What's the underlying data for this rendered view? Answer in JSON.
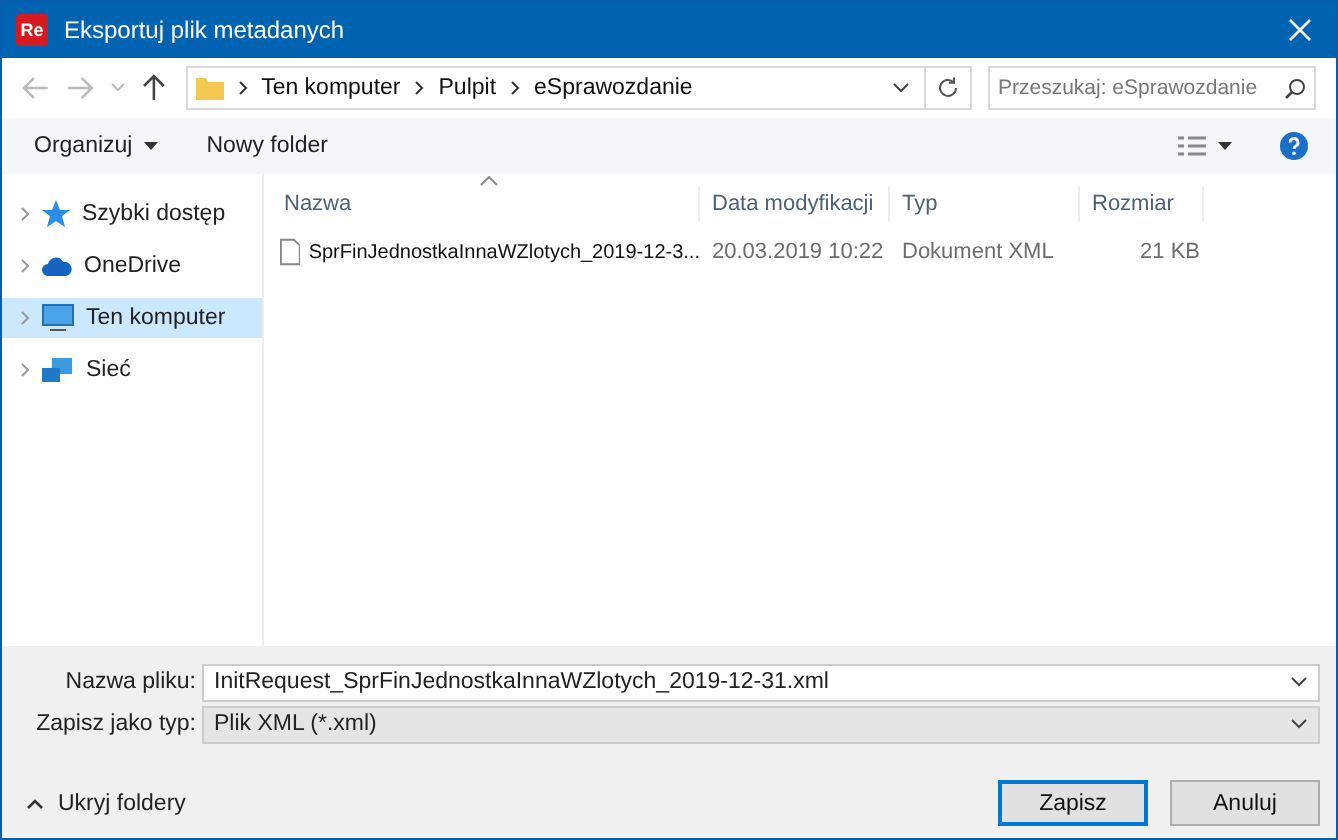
{
  "window": {
    "title": "Eksportuj plik metadanych",
    "app_badge": "Re"
  },
  "address": {
    "path": [
      "Ten komputer",
      "Pulpit",
      "eSprawozdanie"
    ]
  },
  "search": {
    "placeholder": "Przeszukaj: eSprawozdanie"
  },
  "toolbar": {
    "organize": "Organizuj",
    "new_folder": "Nowy folder"
  },
  "sidebar": {
    "items": [
      {
        "label": "Szybki dostęp",
        "kind": "star",
        "selected": false
      },
      {
        "label": "OneDrive",
        "kind": "cloud",
        "selected": false
      },
      {
        "label": "Ten komputer",
        "kind": "pc",
        "selected": true
      },
      {
        "label": "Sieć",
        "kind": "network",
        "selected": false
      }
    ]
  },
  "table": {
    "columns": [
      "Nazwa",
      "Data modyfikacji",
      "Typ",
      "Rozmiar"
    ],
    "rows": [
      {
        "name": "SprFinJednostkaInnaWZlotych_2019-12-3...",
        "modified": "20.03.2019 10:22",
        "type": "Dokument XML",
        "size": "21 KB"
      }
    ]
  },
  "save": {
    "filename_label": "Nazwa pliku:",
    "filename": "InitRequest_SprFinJednostkaInnaWZlotych_2019-12-31.xml",
    "type_label": "Zapisz jako typ:",
    "type": "Plik XML (*.xml)"
  },
  "hide_folders": "Ukryj foldery",
  "buttons": [
    "Zapisz",
    "Anuluj"
  ]
}
